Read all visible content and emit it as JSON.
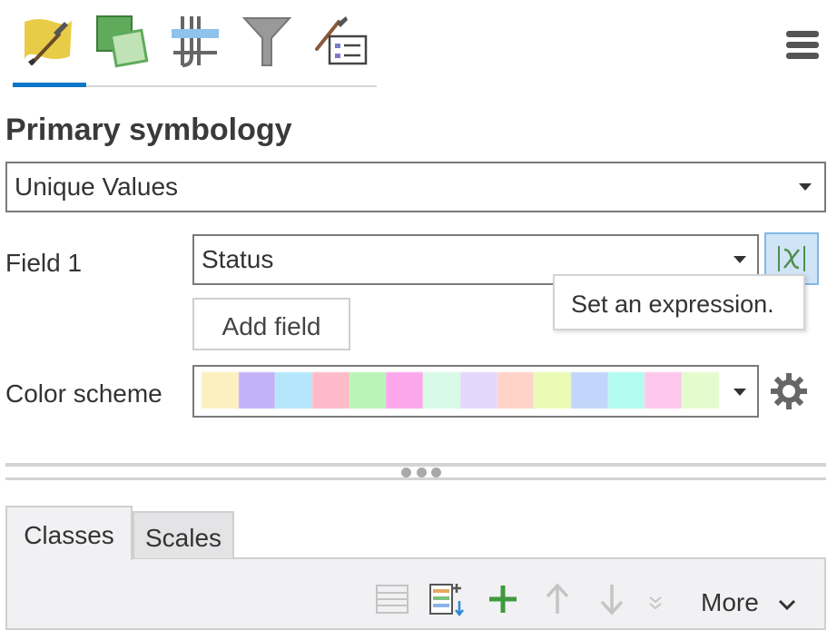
{
  "toolbar": {
    "tabs": [
      {
        "icon": "primary-symbology-brush-icon",
        "active": true
      },
      {
        "icon": "vary-symbology-icon",
        "active": false
      },
      {
        "icon": "symbol-layer-drawing-icon",
        "active": false
      },
      {
        "icon": "filter-funnel-icon",
        "active": false
      },
      {
        "icon": "label-classes-icon",
        "active": false
      }
    ],
    "menu_icon": "hamburger-menu-icon",
    "accent_color": "#0a76c8"
  },
  "header": {
    "title": "Primary symbology"
  },
  "symbology": {
    "method": "Unique Values"
  },
  "field1": {
    "label": "Field 1",
    "value": "Status",
    "expression_icon": "expression-x-icon",
    "tooltip": "Set an expression."
  },
  "add_field": {
    "label": "Add field"
  },
  "color_scheme": {
    "label": "Color scheme",
    "swatches": [
      "#fdf0c0",
      "#c2b2f7",
      "#b6e6fb",
      "#fdbac8",
      "#b8f5b6",
      "#fca6ec",
      "#d7fbe6",
      "#e3d7fb",
      "#ffd3c8",
      "#ebfbb4",
      "#c1d6fa",
      "#b2fbef",
      "#fdc7ec",
      "#e4fbcd"
    ],
    "settings_icon": "gear-icon"
  },
  "tabs": {
    "classes": "Classes",
    "scales": "Scales"
  },
  "classes_toolbar": {
    "icons": [
      "list-view-icon",
      "add-all-values-icon",
      "add-value-plus-icon",
      "move-up-arrow-icon",
      "move-down-arrow-icon",
      "collapse-icon"
    ],
    "more_label": "More"
  }
}
